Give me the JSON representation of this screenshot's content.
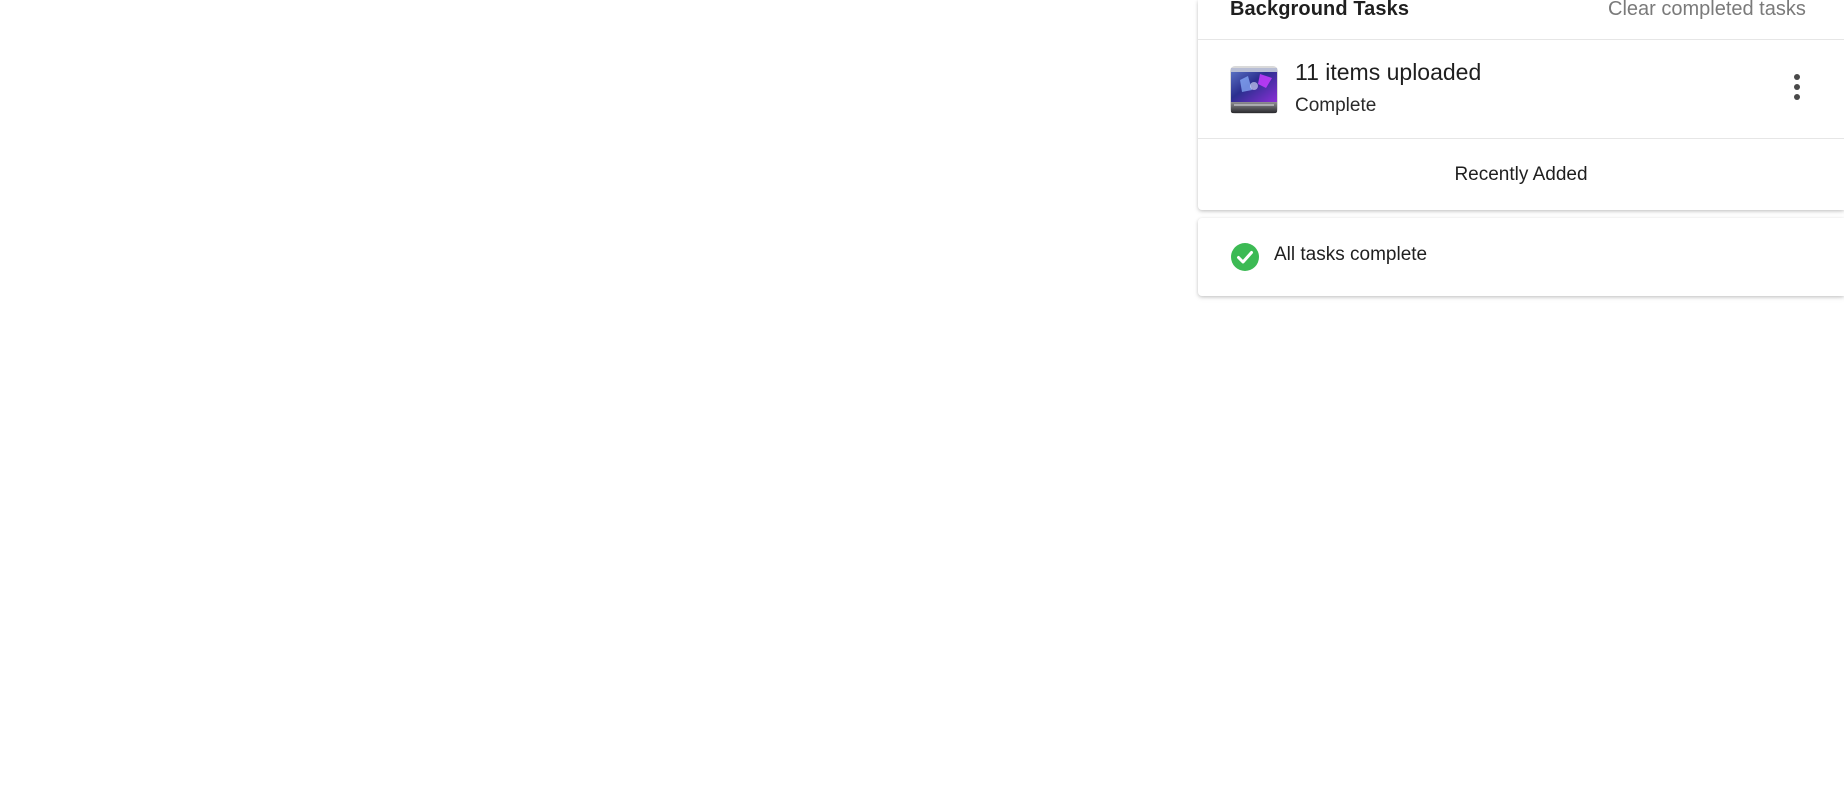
{
  "background_tasks": {
    "title": "Background Tasks",
    "clear_label": "Clear completed tasks",
    "task": {
      "thumbnail_icon": "upload-thumbnail-icon",
      "title": "11 items uploaded",
      "status": "Complete",
      "menu_icon": "more-vertical-icon"
    },
    "recently_added_label": "Recently Added"
  },
  "summary": {
    "icon": "check-circle-icon",
    "text": "All tasks complete",
    "icon_color": "#3cba54"
  },
  "colors": {
    "text_primary": "#1f1f1f",
    "text_muted": "#7a7a7a",
    "divider": "#e6e6e6",
    "success": "#3cba54"
  }
}
